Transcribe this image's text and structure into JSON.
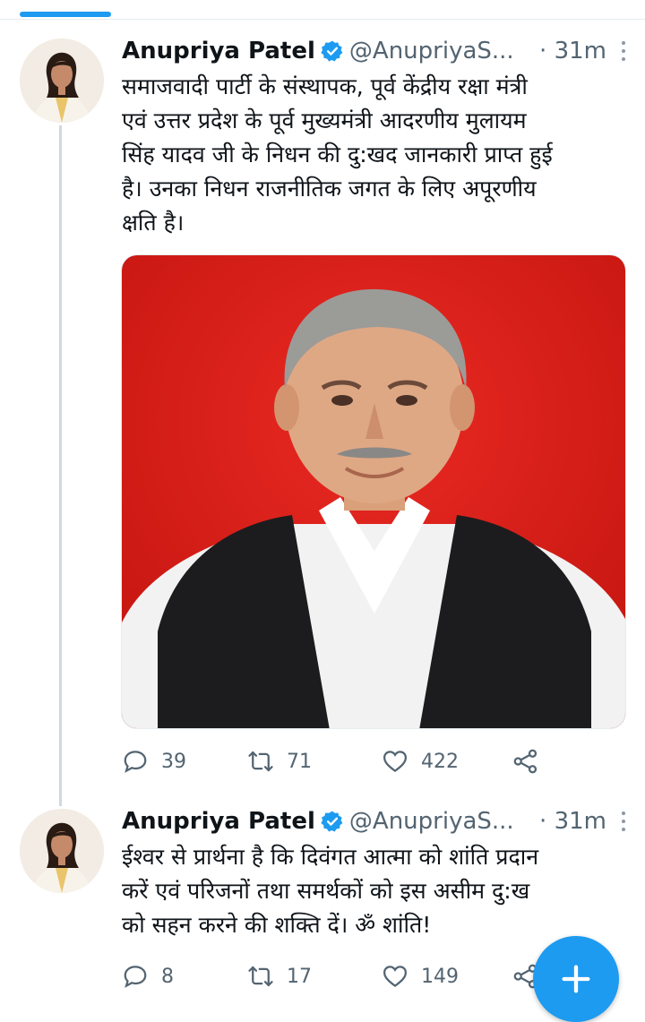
{
  "tweets": [
    {
      "author_name": "Anupriya Patel",
      "handle": "@AnupriyaS...",
      "time": "· 31m",
      "text": "समाजवादी पार्टी के संस्थापक, पूर्व केंद्रीय रक्षा मंत्री\nएवं उत्तर प्रदेश के पूर्व मुख्यमंत्री आदरणीय मुलायम\nसिंह यादव जी के निधन की दु:खद जानकारी प्राप्त हुई\nहै। उनका निधन राजनीतिक जगत के लिए अपूरणीय\nक्षति है।",
      "replies": "39",
      "retweets": "71",
      "likes": "422"
    },
    {
      "author_name": "Anupriya Patel",
      "handle": "@AnupriyaS...",
      "time": "· 31m",
      "text": "ईश्वर से प्रार्थना है कि दिवंगत आत्मा को शांति प्रदान\nकरें एवं परिजनों तथा समर्थकों को इस असीम दु:ख\nको सहन करने की शक्ति दें। ॐ शांति!",
      "replies": "8",
      "retweets": "17",
      "likes": "149"
    }
  ],
  "icons": {
    "verified": "verified-badge-icon",
    "more": "more-vertical-icon",
    "reply": "reply-icon",
    "retweet": "retweet-icon",
    "like": "heart-icon",
    "share": "share-icon",
    "compose": "plus-icon"
  },
  "colors": {
    "accent": "#1d9bf0",
    "secondary_text": "#536471",
    "media_background": "#d81e1e"
  }
}
